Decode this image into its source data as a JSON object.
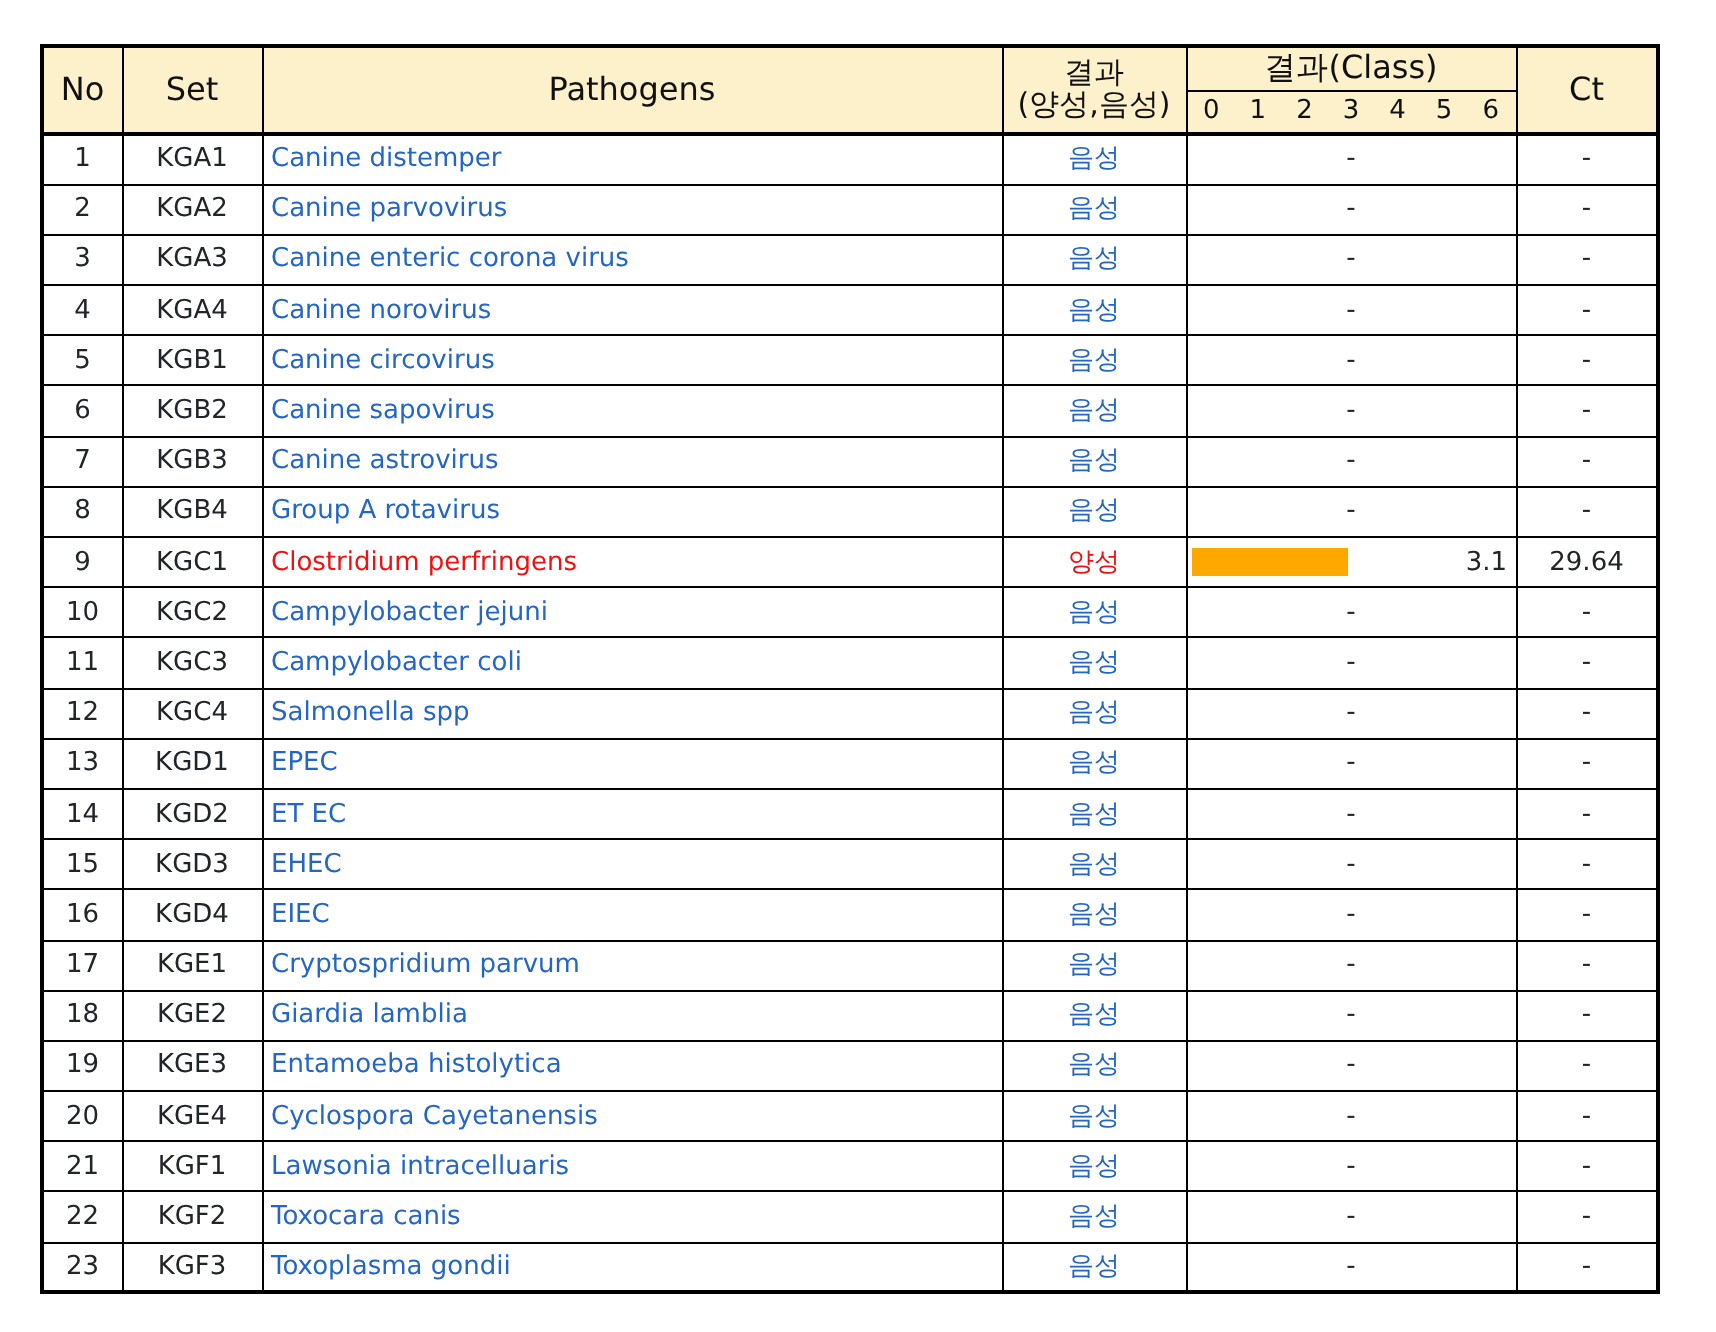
{
  "table": {
    "columns": [
      {
        "label": "No"
      },
      {
        "label": "Set"
      },
      {
        "label": "Pathogens"
      },
      {
        "label": "결과",
        "sublabel": "(양성,음성)"
      },
      {
        "label": "결과(Class)",
        "scale": [
          "0",
          "1",
          "2",
          "3",
          "4",
          "5",
          "6"
        ]
      },
      {
        "label": "Ct"
      }
    ],
    "rows": [
      {
        "no": "1",
        "set": "KGA1",
        "pathogen": "Canine distemper",
        "result": "음성",
        "positive": false,
        "class": "-",
        "ct": "-"
      },
      {
        "no": "2",
        "set": "KGA2",
        "pathogen": "Canine parvovirus",
        "result": "음성",
        "positive": false,
        "class": "-",
        "ct": "-"
      },
      {
        "no": "3",
        "set": "KGA3",
        "pathogen": "Canine enteric corona virus",
        "result": "음성",
        "positive": false,
        "class": "-",
        "ct": "-"
      },
      {
        "no": "4",
        "set": "KGA4",
        "pathogen": "Canine norovirus",
        "result": "음성",
        "positive": false,
        "class": "-",
        "ct": "-"
      },
      {
        "no": "5",
        "set": "KGB1",
        "pathogen": "Canine circovirus",
        "result": "음성",
        "positive": false,
        "class": "-",
        "ct": "-"
      },
      {
        "no": "6",
        "set": "KGB2",
        "pathogen": "Canine sapovirus",
        "result": "음성",
        "positive": false,
        "class": "-",
        "ct": "-"
      },
      {
        "no": "7",
        "set": "KGB3",
        "pathogen": "Canine astrovirus",
        "result": "음성",
        "positive": false,
        "class": "-",
        "ct": "-"
      },
      {
        "no": "8",
        "set": "KGB4",
        "pathogen": "Group A rotavirus",
        "result": "음성",
        "positive": false,
        "class": "-",
        "ct": "-"
      },
      {
        "no": "9",
        "set": "KGC1",
        "pathogen": "Clostridium perfringens",
        "result": "양성",
        "positive": true,
        "class": "3.1",
        "level": 0.49,
        "ct": "29.64"
      },
      {
        "no": "10",
        "set": "KGC2",
        "pathogen": "Campylobacter jejuni",
        "result": "음성",
        "positive": false,
        "class": "-",
        "ct": "-"
      },
      {
        "no": "11",
        "set": "KGC3",
        "pathogen": "Campylobacter coli",
        "result": "음성",
        "positive": false,
        "class": "-",
        "ct": "-"
      },
      {
        "no": "12",
        "set": "KGC4",
        "pathogen": "Salmonella spp",
        "result": "음성",
        "positive": false,
        "class": "-",
        "ct": "-"
      },
      {
        "no": "13",
        "set": "KGD1",
        "pathogen": "EPEC",
        "result": "음성",
        "positive": false,
        "class": "-",
        "ct": "-"
      },
      {
        "no": "14",
        "set": "KGD2",
        "pathogen": "ET EC",
        "result": "음성",
        "positive": false,
        "class": "-",
        "ct": "-"
      },
      {
        "no": "15",
        "set": "KGD3",
        "pathogen": "EHEC",
        "result": "음성",
        "positive": false,
        "class": "-",
        "ct": "-"
      },
      {
        "no": "16",
        "set": "KGD4",
        "pathogen": "EIEC",
        "result": "음성",
        "positive": false,
        "class": "-",
        "ct": "-"
      },
      {
        "no": "17",
        "set": "KGE1",
        "pathogen": "Cryptospridium parvum",
        "result": "음성",
        "positive": false,
        "class": "-",
        "ct": "-"
      },
      {
        "no": "18",
        "set": "KGE2",
        "pathogen": "Giardia lamblia",
        "result": "음성",
        "positive": false,
        "class": "-",
        "ct": "-"
      },
      {
        "no": "19",
        "set": "KGE3",
        "pathogen": "Entamoeba histolytica",
        "result": "음성",
        "positive": false,
        "class": "-",
        "ct": "-"
      },
      {
        "no": "20",
        "set": "KGE4",
        "pathogen": "Cyclospora Cayetanensis",
        "result": "음성",
        "positive": false,
        "class": "-",
        "ct": "-"
      },
      {
        "no": "21",
        "set": "KGF1",
        "pathogen": "Lawsonia intracelluaris",
        "result": "음성",
        "positive": false,
        "class": "-",
        "ct": "-"
      },
      {
        "no": "22",
        "set": "KGF2",
        "pathogen": "Toxocara canis",
        "result": "음성",
        "positive": false,
        "class": "-",
        "ct": "-"
      },
      {
        "no": "23",
        "set": "KGF3",
        "pathogen": "Toxoplasma gondii",
        "result": "음성",
        "positive": false,
        "class": "-",
        "ct": "-"
      }
    ]
  }
}
